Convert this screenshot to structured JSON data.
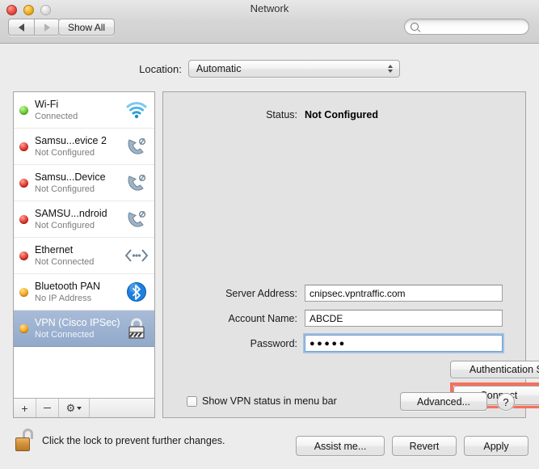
{
  "window": {
    "title": "Network",
    "traffic_lights": [
      "close",
      "minimize",
      "zoom"
    ]
  },
  "toolbar": {
    "back_label": "back",
    "forward_label": "forward",
    "show_all_label": "Show All",
    "search_value": "",
    "search_placeholder": ""
  },
  "location": {
    "label": "Location:",
    "selected": "Automatic",
    "options": [
      "Automatic"
    ]
  },
  "sidebar": {
    "services": [
      {
        "name": "Wi-Fi",
        "status": "Connected",
        "dot": "green",
        "icon": "wifi-icon",
        "selected": false
      },
      {
        "name": "Samsu...evice 2",
        "status": "Not Configured",
        "dot": "red",
        "icon": "modem-icon",
        "selected": false
      },
      {
        "name": "Samsu...Device",
        "status": "Not Configured",
        "dot": "red",
        "icon": "modem-icon",
        "selected": false
      },
      {
        "name": "SAMSU...ndroid",
        "status": "Not Configured",
        "dot": "red",
        "icon": "modem-icon",
        "selected": false
      },
      {
        "name": "Ethernet",
        "status": "Not Connected",
        "dot": "red",
        "icon": "ethernet-icon",
        "selected": false
      },
      {
        "name": "Bluetooth PAN",
        "status": "No IP Address",
        "dot": "orange",
        "icon": "bluetooth-icon",
        "selected": false
      },
      {
        "name": "VPN (Cisco IPSec)",
        "status": "Not Connected",
        "dot": "orange",
        "icon": "lock-icon",
        "selected": true
      }
    ],
    "toolbar": {
      "add_label": "+",
      "remove_label": "−",
      "actions_label": "gear"
    }
  },
  "detail": {
    "status_label": "Status:",
    "status_value": "Not Configured",
    "fields": [
      {
        "label": "Server Address:",
        "value": "cnipsec.vpntraffic.com",
        "focused": false,
        "type": "text"
      },
      {
        "label": "Account Name:",
        "value": "ABCDE",
        "focused": false,
        "type": "text"
      },
      {
        "label": "Password:",
        "value": "●●●●●",
        "focused": true,
        "type": "password"
      }
    ],
    "auth_settings_label": "Authentication Settings...",
    "connect_label": "Connect",
    "show_status_label": "Show VPN status in menu bar",
    "show_status_checked": false,
    "advanced_label": "Advanced...",
    "help_label": "?"
  },
  "annotations": {
    "highlight_color": "#f4705e",
    "highlight_target": "Connect",
    "arrow_color": "#f4705e",
    "arrow_points_to": "Connect"
  },
  "footer": {
    "lock_text": "Click the lock to prevent further changes.",
    "lock_state": "unlocked",
    "assist_label": "Assist me...",
    "revert_label": "Revert",
    "apply_label": "Apply"
  }
}
